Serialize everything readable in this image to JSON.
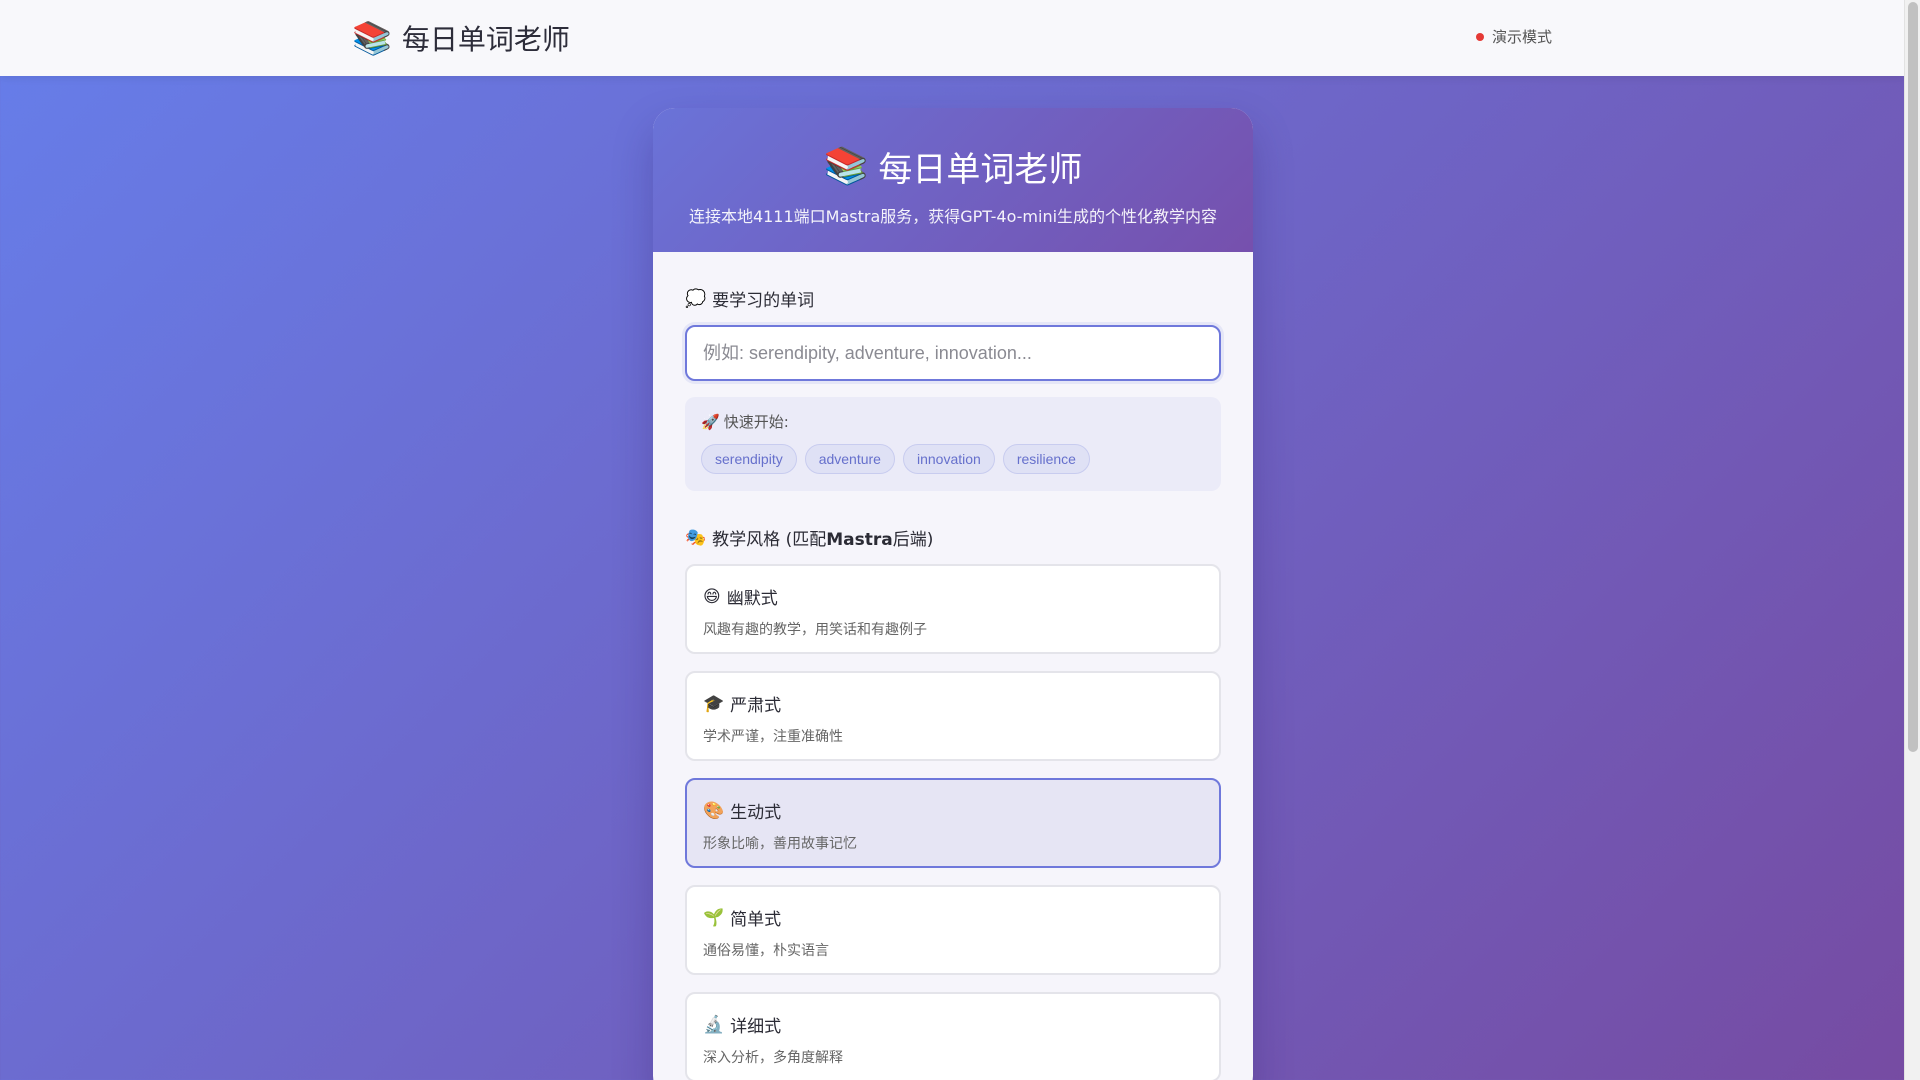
{
  "topbar": {
    "brand_icon": "books-icon",
    "brand_title": "每日单词老师",
    "mode_label": "演示模式",
    "mode_dot_color": "#e53935"
  },
  "card": {
    "title_icon": "books-icon",
    "title": "每日单词老师",
    "subtitle": "连接本地4111端口Mastra服务，获得GPT-4o-mini生成的个性化教学内容"
  },
  "word": {
    "label": "要学习的单词",
    "value": "",
    "placeholder": "例如: serendipity, adventure, innovation..."
  },
  "quick_start": {
    "label": "快速开始:",
    "chips": [
      "serendipity",
      "adventure",
      "innovation",
      "resilience"
    ]
  },
  "styles": {
    "label_prefix": "教学风格 (匹配",
    "label_bold": "Mastra",
    "label_suffix": "后端)",
    "items": [
      {
        "icon": "😄",
        "name": "幽默式",
        "desc": "风趣有趣的教学，用笑话和有趣例子",
        "selected": false
      },
      {
        "icon": "🎓",
        "name": "严肃式",
        "desc": "学术严谨，注重准确性",
        "selected": false
      },
      {
        "icon": "🎨",
        "name": "生动式",
        "desc": "形象比喻，善用故事记忆",
        "selected": true
      },
      {
        "icon": "🌱",
        "name": "简单式",
        "desc": "通俗易懂，朴实语言",
        "selected": false
      },
      {
        "icon": "🔬",
        "name": "详细式",
        "desc": "深入分析，多角度解释",
        "selected": false
      }
    ]
  },
  "colors": {
    "accent": "#6f78db",
    "gradient_start": "#667eea",
    "gradient_end": "#764ba2"
  }
}
